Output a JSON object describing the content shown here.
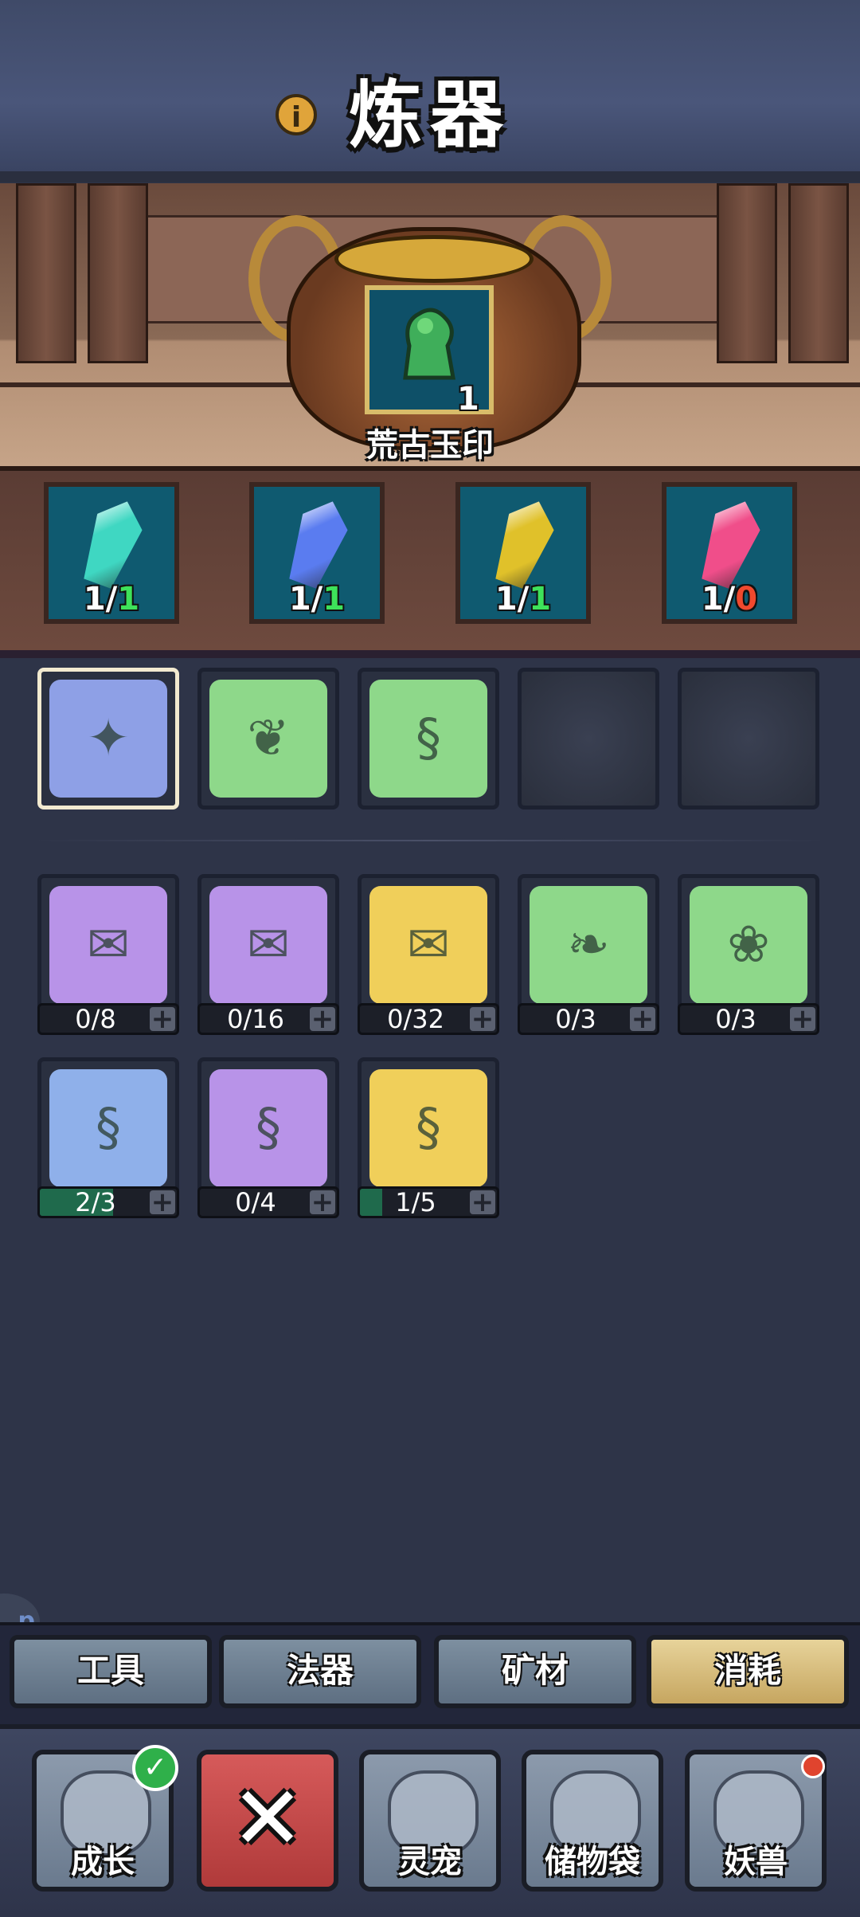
{
  "header": {
    "title": "炼器",
    "info_icon": "info-icon"
  },
  "product": {
    "name": "荒古玉印",
    "quantity": "1",
    "icon": "jade-seal-icon"
  },
  "crystals": [
    {
      "icon": "cyan-crystal-icon",
      "color": "#3fd7c2",
      "have": "1/",
      "need": "1",
      "need_color": "#3ee25a"
    },
    {
      "icon": "blue-crystal-icon",
      "color": "#5a7cf0",
      "have": "1/",
      "need": "1",
      "need_color": "#3ee25a"
    },
    {
      "icon": "gold-crystal-icon",
      "color": "#e0c12a",
      "have": "1/",
      "need": "1",
      "need_color": "#3ee25a"
    },
    {
      "icon": "pink-crystal-icon",
      "color": "#f04e8a",
      "have": "1/",
      "need": "0",
      "need_color": "#f0492e"
    }
  ],
  "recipe_slots": [
    {
      "icon": "jade-seal-icon",
      "paper_color": "#8ea0e6",
      "selected": true
    },
    {
      "icon": "scroll-icon",
      "paper_color": "#8ed88a",
      "selected": false
    },
    {
      "icon": "talisman-icon",
      "paper_color": "#8ed88a",
      "selected": false
    },
    {
      "icon": "empty-slot-icon",
      "empty": true
    },
    {
      "icon": "empty-slot-icon",
      "empty": true
    }
  ],
  "materials": [
    {
      "icon": "yellow-scroll-icon",
      "paper_color": "#b893e8",
      "count": "0/8",
      "progress": 0
    },
    {
      "icon": "red-scroll-icon",
      "paper_color": "#b893e8",
      "count": "0/16",
      "progress": 0
    },
    {
      "icon": "golden-scroll-icon",
      "paper_color": "#f0cf5a",
      "count": "0/32",
      "progress": 0
    },
    {
      "icon": "feather-leaf-icon",
      "paper_color": "#8ed88a",
      "count": "0/3",
      "progress": 0
    },
    {
      "icon": "spirit-herb-icon",
      "paper_color": "#8ed88a",
      "count": "0/3",
      "progress": 0
    },
    {
      "icon": "blue-talisman-icon",
      "paper_color": "#8fb0ea",
      "count": "2/3",
      "progress": 0.667
    },
    {
      "icon": "purple-talisman-icon",
      "paper_color": "#b893e8",
      "count": "0/4",
      "progress": 0
    },
    {
      "icon": "yellow-talisman-icon",
      "paper_color": "#f0cf5a",
      "count": "1/5",
      "progress": 0.2
    }
  ],
  "tabs": [
    {
      "label": "工具",
      "active": false
    },
    {
      "label": "法器",
      "active": false
    },
    {
      "label": "矿材",
      "active": false
    },
    {
      "label": "消耗",
      "active": true
    }
  ],
  "nav": [
    {
      "label": "成长",
      "icon": "growth-icon",
      "badge": "check-badge-icon"
    },
    {
      "label": "",
      "icon": "close-icon"
    },
    {
      "label": "灵宠",
      "icon": "spirit-pet-icon"
    },
    {
      "label": "储物袋",
      "icon": "storage-bag-icon"
    },
    {
      "label": "妖兽",
      "icon": "demon-beast-icon",
      "badge": "red-dot-icon"
    }
  ],
  "side_bubble": "p"
}
